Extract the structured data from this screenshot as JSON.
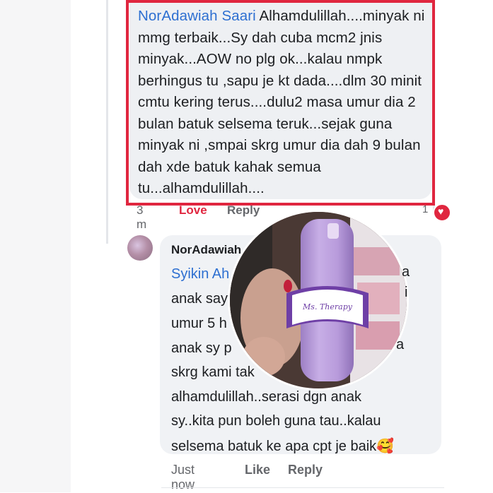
{
  "comment1": {
    "author": "NorAdawiah Saari",
    "text": " Alhamdulillah....minyak ni mmg terbaik...Sy dah cuba mcm2 jnis minyak...AOW no plg ok...kalau nmpk berhingus tu ,sapu je kt dada....dlm 30 minit cmtu kering terus....dulu2 masa umur dia 2 bulan batuk selsema teruk...sejak guna minyak ni ,smpai skrg umur dia dah 9 bulan dah xde batuk kahak semua tu...alhamdulillah....",
    "time": "3 m",
    "love_label": "Love",
    "reply_label": "Reply",
    "reaction_count": "1"
  },
  "reply": {
    "author": "NorAdawiah",
    "mention": "Syikin Ah",
    "lines": [
      "a",
      "anak say",
      "i",
      "umur 5 h",
      "anak sy p",
      "a",
      "skrg kami tak",
      "alhamdulillah..serasi dgn anak",
      "sy..kita pun boleh guna tau..kalau",
      "selsema batuk ke apa cpt je baik"
    ],
    "emoji_smile": "☺",
    "emoji_love": "🥰",
    "time": "Just now",
    "like_label": "Like",
    "reply_label": "Reply"
  },
  "product": {
    "brand_text": "Ms. Therapy",
    "bottle_color": "#b79ad8",
    "label_color": "#6e3fa6"
  },
  "colors": {
    "highlight": "#e0263f",
    "link": "#2d6fd1",
    "bubble": "#f0f2f5"
  }
}
